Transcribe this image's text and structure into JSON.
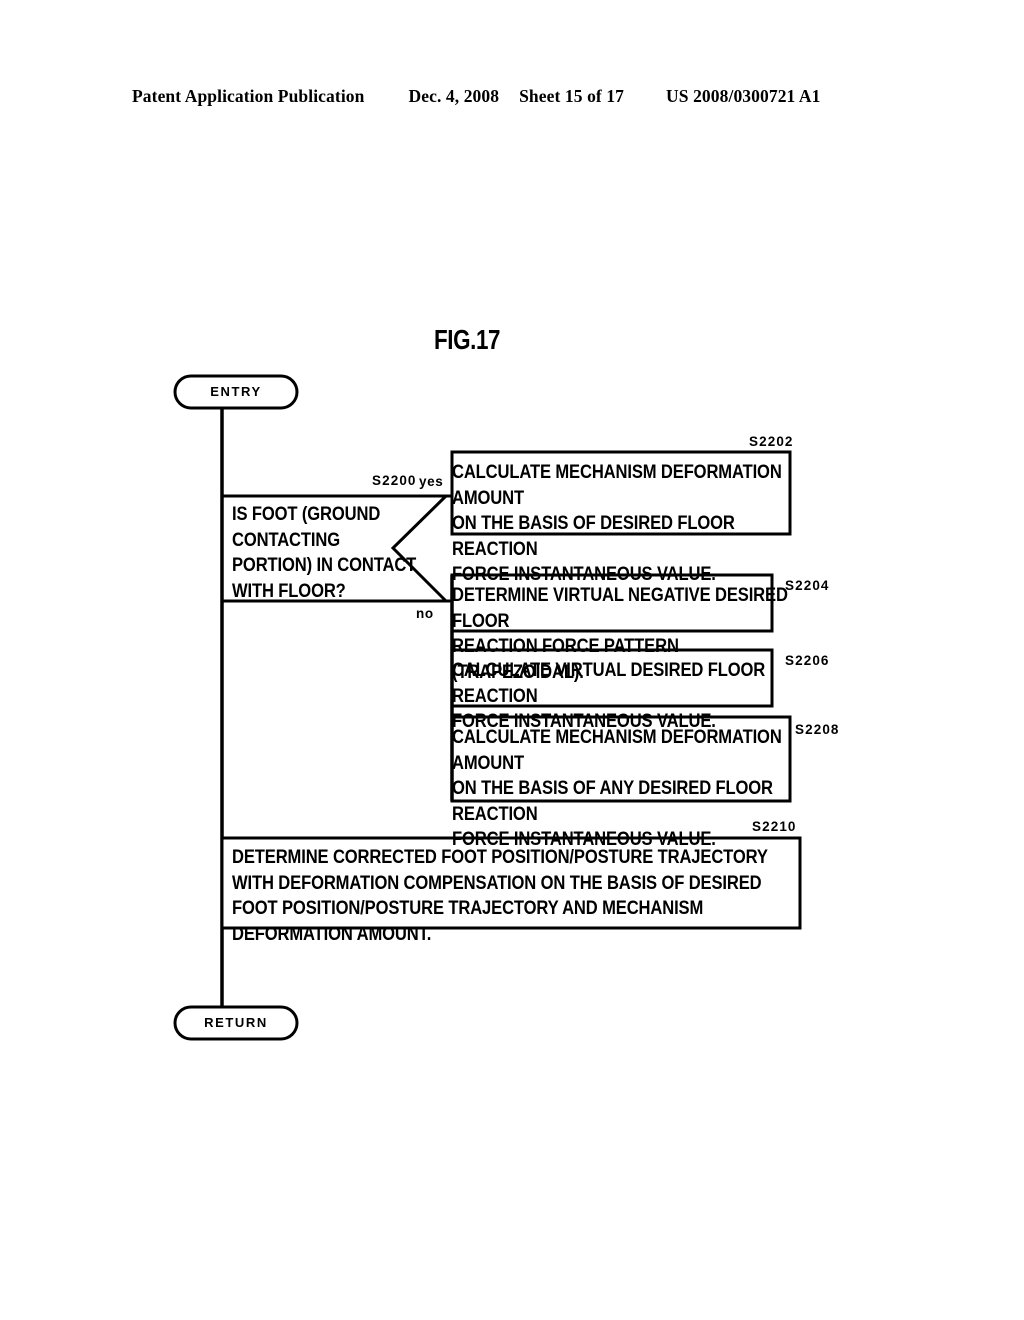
{
  "header": {
    "publication": "Patent Application Publication",
    "date": "Dec. 4, 2008",
    "sheet": "Sheet 15 of 17",
    "patent_number": "US 2008/0300721 A1"
  },
  "figure": {
    "title": "FIG.17"
  },
  "flowchart": {
    "entry_label": "ENTRY",
    "return_label": "RETURN",
    "decision": {
      "ref": "S2200",
      "text": "IS FOOT (GROUND\nCONTACTING\nPORTION) IN CONTACT\nWITH FLOOR?",
      "yes_label": "yes",
      "no_label": "no"
    },
    "steps": [
      {
        "ref": "S2202",
        "text": "CALCULATE MECHANISM DEFORMATION AMOUNT\nON THE BASIS OF DESIRED FLOOR REACTION\nFORCE INSTANTANEOUS VALUE."
      },
      {
        "ref": "S2204",
        "text": "DETERMINE VIRTUAL NEGATIVE DESIRED FLOOR\nREACTION FORCE PATTERN (TRAPEZOIDAL)."
      },
      {
        "ref": "S2206",
        "text": "CALCULATE VIRTUAL DESIRED FLOOR REACTION\nFORCE INSTANTANEOUS VALUE."
      },
      {
        "ref": "S2208",
        "text": "CALCULATE MECHANISM DEFORMATION AMOUNT\nON THE BASIS OF ANY DESIRED FLOOR REACTION\nFORCE INSTANTANEOUS VALUE."
      },
      {
        "ref": "S2210",
        "text": "DETERMINE CORRECTED FOOT POSITION/POSTURE TRAJECTORY\nWITH DEFORMATION COMPENSATION ON THE BASIS OF DESIRED\nFOOT POSITION/POSTURE TRAJECTORY AND MECHANISM DEFORMATION AMOUNT."
      }
    ]
  },
  "colors": {
    "ink": "#000000",
    "paper": "#ffffff"
  }
}
